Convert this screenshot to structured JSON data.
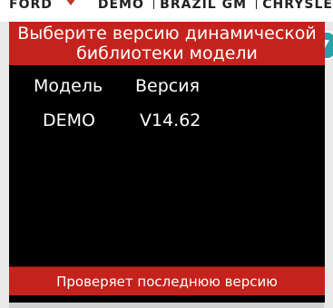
{
  "background": {
    "brands": [
      "FORD",
      "DEMO",
      "BRAZIL GM",
      "CHRYSLE"
    ]
  },
  "dialog": {
    "title_line1": "Выберите версию динамической",
    "title_line2": "библиотеки модели",
    "columns": {
      "model": "Модель",
      "version": "Версия"
    },
    "rows": [
      {
        "model": "DEMO",
        "version": "V14.62"
      }
    ],
    "check_button_label": "Проверяет последнюю версию"
  },
  "colors": {
    "accent_red": "#c4221c",
    "dialog_bg": "#000000",
    "side_button": "#2aa0a8"
  },
  "icons": {
    "side_button": "arrow-down-icon"
  }
}
